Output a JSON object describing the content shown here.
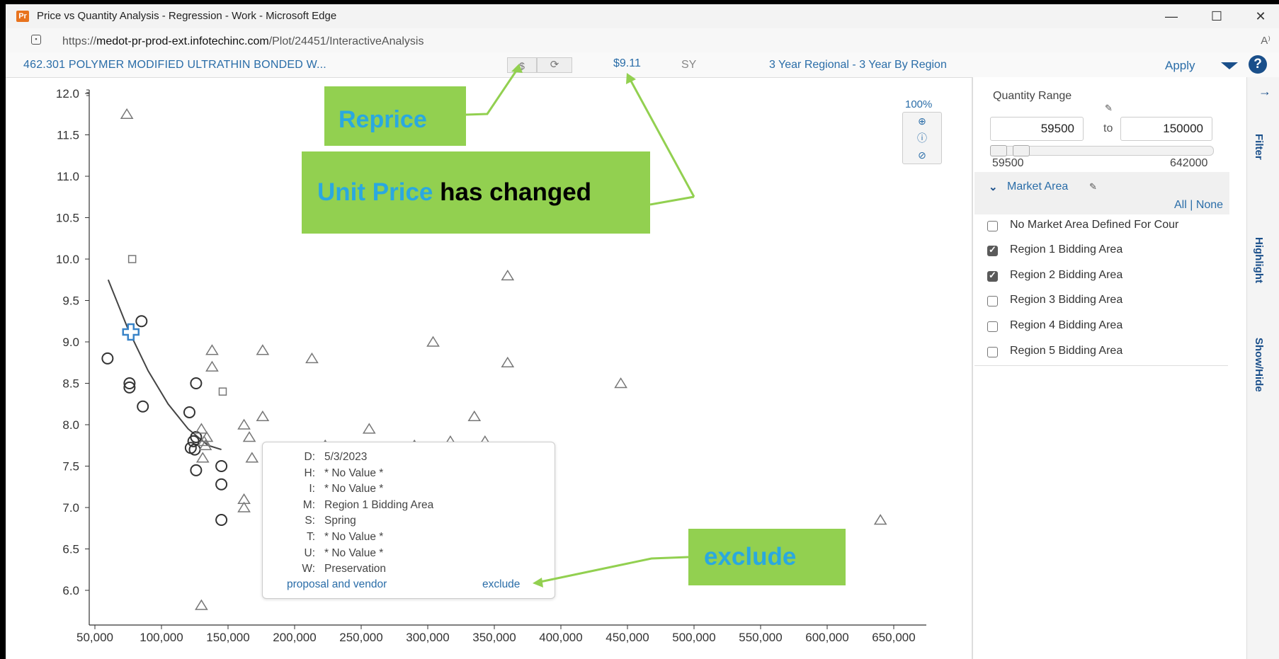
{
  "window": {
    "app_icon_text": "Pr",
    "title": "Price vs Quantity Analysis - Regression - Work - Microsoft Edge",
    "controls": {
      "minimize": "—",
      "maximize": "☐",
      "close": "✕"
    }
  },
  "address": {
    "url_prefix": "https://",
    "url_domain": "medot-pr-prod-ext.infotechinc.com",
    "url_path": "/Plot/24451/InteractiveAnalysis",
    "read_aloud": "A⁾"
  },
  "toolbar": {
    "item_title": "462.301 POLYMER MODIFIED ULTRATHIN BONDED W...",
    "reprice_label": "$",
    "refresh_icon": "refresh-icon",
    "unit_price": "$9.11",
    "unit": "SY",
    "region_filter": "3 Year Regional - 3 Year By Region",
    "apply_label": "Apply",
    "help_label": "?"
  },
  "callouts": {
    "reprice": {
      "text": "Reprice",
      "color": "#2aa8e0"
    },
    "unit_price": {
      "highlight": "Unit Price",
      "rest": " has changed",
      "highlight_color": "#2aa8e0",
      "text_color": "#000000"
    },
    "exclude": {
      "text": "exclude",
      "color": "#2aa8e0"
    },
    "background": "#92d050",
    "arrow_color": "#92d050"
  },
  "zoom": {
    "percent": "100%",
    "buttons": [
      "zoom-in-icon",
      "info-icon",
      "reset-icon"
    ]
  },
  "tooltip": {
    "rows": [
      {
        "key": "D:",
        "value": "5/3/2023"
      },
      {
        "key": "H:",
        "value": "* No Value *"
      },
      {
        "key": "I:",
        "value": "* No Value *"
      },
      {
        "key": "M:",
        "value": "Region 1 Bidding Area"
      },
      {
        "key": "S:",
        "value": "Spring"
      },
      {
        "key": "T:",
        "value": "* No Value *"
      },
      {
        "key": "U:",
        "value": "* No Value *"
      },
      {
        "key": "W:",
        "value": "Preservation"
      }
    ],
    "link_left": "proposal and vendor",
    "link_right": "exclude"
  },
  "chart_data": {
    "type": "scatter",
    "xlim": [
      50000,
      650000
    ],
    "ylim": [
      5.75,
      12.0
    ],
    "x_ticks": [
      50000,
      100000,
      150000,
      200000,
      250000,
      300000,
      350000,
      400000,
      450000,
      500000,
      550000,
      600000,
      650000
    ],
    "x_tick_labels": [
      "50,000",
      "100,000",
      "150,000",
      "200,000",
      "250,000",
      "300,000",
      "350,000",
      "400,000",
      "450,000",
      "500,000",
      "550,000",
      "600,000",
      "650,000"
    ],
    "y_ticks": [
      6.0,
      6.5,
      7.0,
      7.5,
      8.0,
      8.5,
      9.0,
      9.5,
      10.0,
      10.5,
      11.0,
      11.5,
      12.0
    ],
    "y_tick_labels": [
      "6.0",
      "6.5",
      "7.0",
      "7.5",
      "8.0",
      "8.5",
      "9.0",
      "9.5",
      "10.0",
      "10.5",
      "11.0",
      "11.5",
      "12.0"
    ],
    "grid": false,
    "series": [
      {
        "marker": "circle",
        "points": [
          [
            59500,
            8.8
          ],
          [
            76000,
            8.5
          ],
          [
            76000,
            8.45
          ],
          [
            85000,
            9.25
          ],
          [
            86000,
            8.22
          ],
          [
            121000,
            8.15
          ],
          [
            122000,
            7.72
          ],
          [
            124000,
            7.8
          ],
          [
            125000,
            7.7
          ],
          [
            126000,
            7.85
          ],
          [
            126000,
            7.45
          ],
          [
            126000,
            8.5
          ],
          [
            145000,
            7.5
          ],
          [
            145000,
            7.28
          ],
          [
            145000,
            6.85
          ]
        ]
      },
      {
        "marker": "square",
        "points": [
          [
            78000,
            10.0
          ],
          [
            146000,
            8.4
          ]
        ]
      },
      {
        "marker": "triangle",
        "points": [
          [
            74000,
            11.75
          ],
          [
            130000,
            7.95
          ],
          [
            131000,
            7.6
          ],
          [
            132000,
            7.8
          ],
          [
            133000,
            7.75
          ],
          [
            134000,
            7.85
          ],
          [
            130000,
            5.82
          ],
          [
            138000,
            8.9
          ],
          [
            138000,
            8.7
          ],
          [
            162000,
            8.0
          ],
          [
            166000,
            7.85
          ],
          [
            168000,
            7.6
          ],
          [
            162000,
            7.1
          ],
          [
            162000,
            7.0
          ],
          [
            176000,
            8.1
          ],
          [
            176000,
            8.9
          ],
          [
            213000,
            8.8
          ],
          [
            223000,
            7.75
          ],
          [
            256000,
            7.95
          ],
          [
            290000,
            7.75
          ],
          [
            304000,
            9.0
          ],
          [
            317000,
            7.8
          ],
          [
            335000,
            8.1
          ],
          [
            343000,
            7.8
          ],
          [
            360000,
            9.8
          ],
          [
            360000,
            8.75
          ],
          [
            445000,
            8.5
          ],
          [
            640000,
            6.85
          ]
        ]
      },
      {
        "marker": "cross-selected",
        "points": [
          [
            77000,
            9.12
          ]
        ]
      }
    ],
    "regression_curve": [
      [
        60000,
        9.75
      ],
      [
        75000,
        9.15
      ],
      [
        90000,
        8.65
      ],
      [
        105000,
        8.25
      ],
      [
        120000,
        7.95
      ],
      [
        135000,
        7.75
      ],
      [
        145000,
        7.7
      ]
    ]
  },
  "panel": {
    "quantity_range_label": "Quantity Range",
    "qty_min": "59500",
    "to_label": "to",
    "qty_max": "150000",
    "slider_min_label": "59500",
    "slider_max_label": "642000",
    "market_area_label": "Market Area",
    "all_none": "All | None",
    "regions": [
      {
        "label": "No Market Area Defined For Cour",
        "checked": false
      },
      {
        "label": "Region 1 Bidding Area",
        "checked": true
      },
      {
        "label": "Region 2 Bidding Area",
        "checked": true
      },
      {
        "label": "Region 3 Bidding Area",
        "checked": false
      },
      {
        "label": "Region 4 Bidding Area",
        "checked": false
      },
      {
        "label": "Region 5 Bidding Area",
        "checked": false
      }
    ]
  },
  "side_tabs": {
    "arrow": "→",
    "filter": "Filter",
    "highlight": "Highlight",
    "show_hide": "Show/Hide"
  }
}
